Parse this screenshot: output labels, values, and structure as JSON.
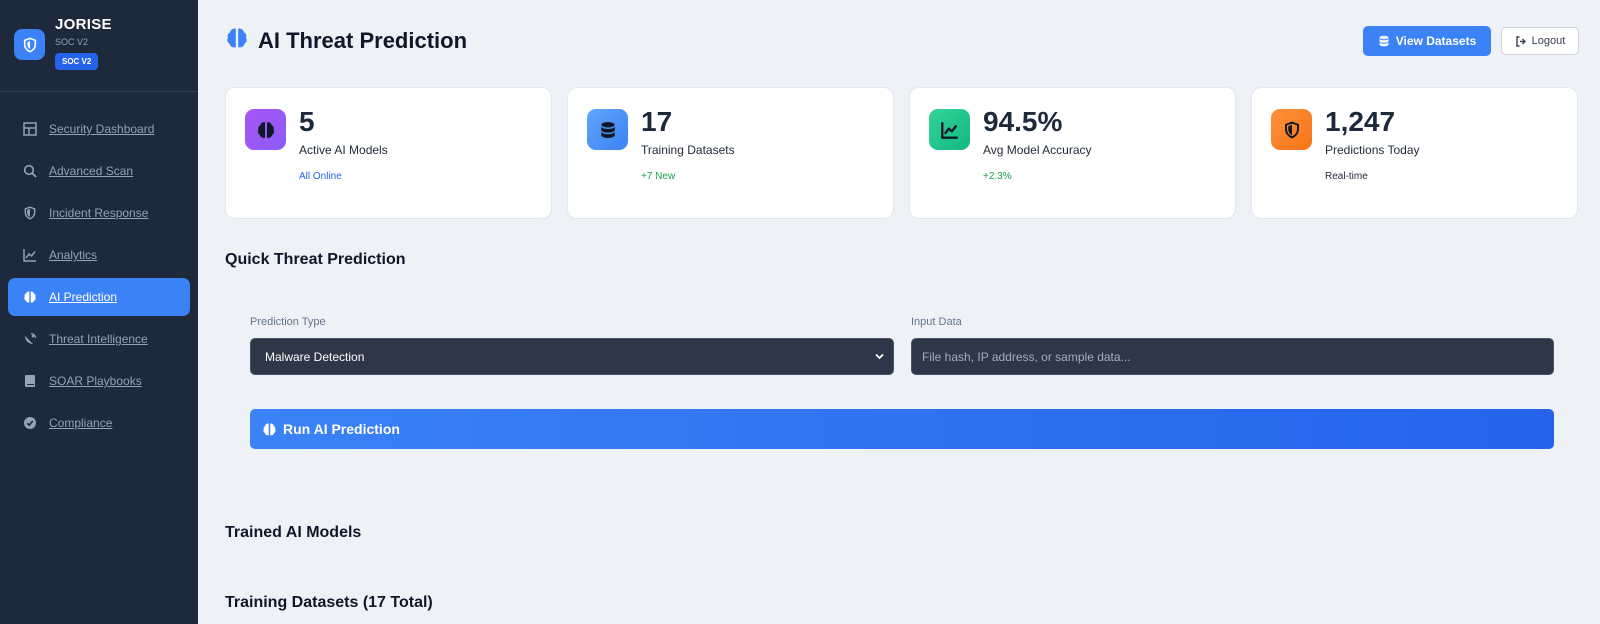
{
  "brand": {
    "name": "JORISE",
    "subtitle": "SOC V2",
    "badge": "SOC V2"
  },
  "sidebar": {
    "items": [
      {
        "label": "Security Dashboard",
        "icon": "dashboard-grid-icon",
        "active": false
      },
      {
        "label": "Advanced Scan",
        "icon": "search-icon",
        "active": false
      },
      {
        "label": "Incident Response",
        "icon": "shield-half-icon",
        "active": false
      },
      {
        "label": "Analytics",
        "icon": "line-chart-icon",
        "active": false
      },
      {
        "label": "AI Prediction",
        "icon": "brain-icon",
        "active": true
      },
      {
        "label": "Threat Intelligence",
        "icon": "satellite-dish-icon",
        "active": false
      },
      {
        "label": "SOAR Playbooks",
        "icon": "book-icon",
        "active": false
      },
      {
        "label": "Compliance",
        "icon": "check-badge-icon",
        "active": false
      }
    ]
  },
  "header": {
    "title": "AI Threat Prediction",
    "view_datasets_label": "View Datasets",
    "logout_label": "Logout"
  },
  "stats": [
    {
      "value": "5",
      "label": "Active AI Models",
      "note": "All Online",
      "icon": "brain-icon",
      "color": "#8b5cf6",
      "note_color": "#2563eb"
    },
    {
      "value": "17",
      "label": "Training Datasets",
      "note": "+7 New",
      "icon": "database-icon",
      "color": "#3b82f6",
      "note_color": "#16a34a"
    },
    {
      "value": "94.5%",
      "label": "Avg Model Accuracy",
      "note": "+2.3%",
      "icon": "line-chart-icon",
      "color": "#10b981",
      "note_color": "#16a34a"
    },
    {
      "value": "1,247",
      "label": "Predictions Today",
      "note": "Real-time",
      "icon": "shield-half-icon",
      "color": "#f97316",
      "note_color": "#1f2937"
    }
  ],
  "quick": {
    "title": "Quick Threat Prediction",
    "type_label": "Prediction Type",
    "type_value": "Malware Detection",
    "input_label": "Input Data",
    "input_placeholder": "File hash, IP address, or sample data...",
    "run_label": "Run AI Prediction"
  },
  "sections": {
    "trained_models": "Trained AI Models",
    "training_datasets": "Training Datasets (17 Total)"
  },
  "colors": {
    "sidebar_bg": "#1e293b",
    "accent": "#3b82f6",
    "page_bg": "#eef2f7"
  }
}
